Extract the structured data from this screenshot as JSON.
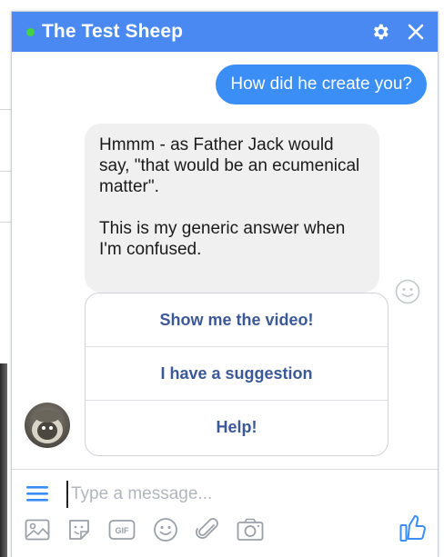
{
  "header": {
    "title": "The Test Sheep",
    "status": "online",
    "icons": [
      "gear-icon",
      "close-icon"
    ]
  },
  "messages": {
    "user": "How did he create you?",
    "bot_paragraphs": [
      "Hmmm - as Father Jack would say, \"that would be an ecumenical matter\".",
      "This is my generic answer when I'm confused."
    ]
  },
  "quick_replies": [
    "Show me the video!",
    "I have a suggestion",
    "Help!"
  ],
  "composer": {
    "placeholder": "Type a message...",
    "toolbar_icons": [
      "image-icon",
      "sticker-icon",
      "gif-icon",
      "emoji-icon",
      "attachment-icon",
      "camera-icon"
    ],
    "like_icon": "thumbs-up-icon"
  },
  "colors": {
    "header": "#4a89f2",
    "user_bubble": "#3a8ef6",
    "quick_reply_text": "#3b5998",
    "status_dot": "#42d442"
  }
}
